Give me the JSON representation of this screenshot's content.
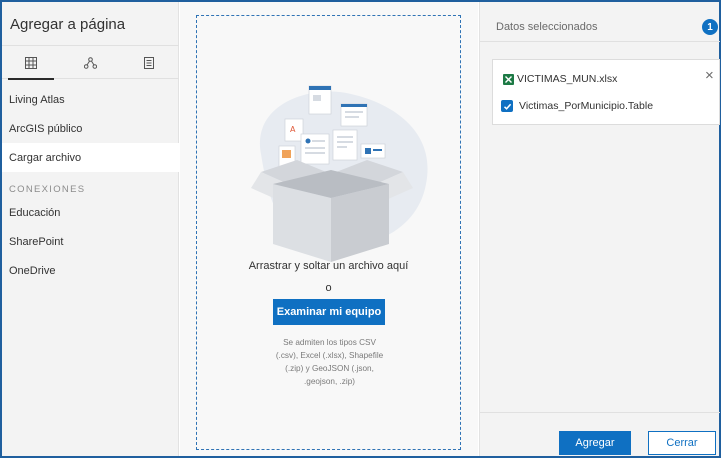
{
  "sidebar": {
    "title": "Agregar a página",
    "tabs": [
      {
        "icon": "grid-icon"
      },
      {
        "icon": "network-icon"
      },
      {
        "icon": "document-icon"
      }
    ],
    "items": [
      {
        "label": "Living Atlas"
      },
      {
        "label": "ArcGIS público"
      },
      {
        "label": "Cargar archivo",
        "active": true
      }
    ],
    "section_label": "CONEXIONES",
    "connections": [
      {
        "label": "Educación"
      },
      {
        "label": "SharePoint"
      },
      {
        "label": "OneDrive"
      }
    ]
  },
  "upload": {
    "drop_text": "Arrastrar y soltar un archivo aquí",
    "or_text": "o",
    "browse_label": "Examinar mi equipo",
    "help_lines": [
      "Se admiten los tipos CSV",
      "(.csv), Excel (.xlsx), Shapefile",
      "(.zip) y GeoJSON (.json,",
      ".geojson, .zip)"
    ]
  },
  "selected": {
    "title": "Datos seleccionados",
    "count": "1",
    "file": {
      "name": "VICTIMAS_MUN.xlsx",
      "icon": "excel-icon"
    },
    "table": {
      "name": "Victimas_PorMunicipio.Table",
      "checked": true
    }
  },
  "footer": {
    "add_label": "Agregar",
    "close_label": "Cerrar"
  },
  "colors": {
    "accent": "#0f70c2",
    "frame": "#1f5f9e",
    "excel": "#1d7a45"
  }
}
